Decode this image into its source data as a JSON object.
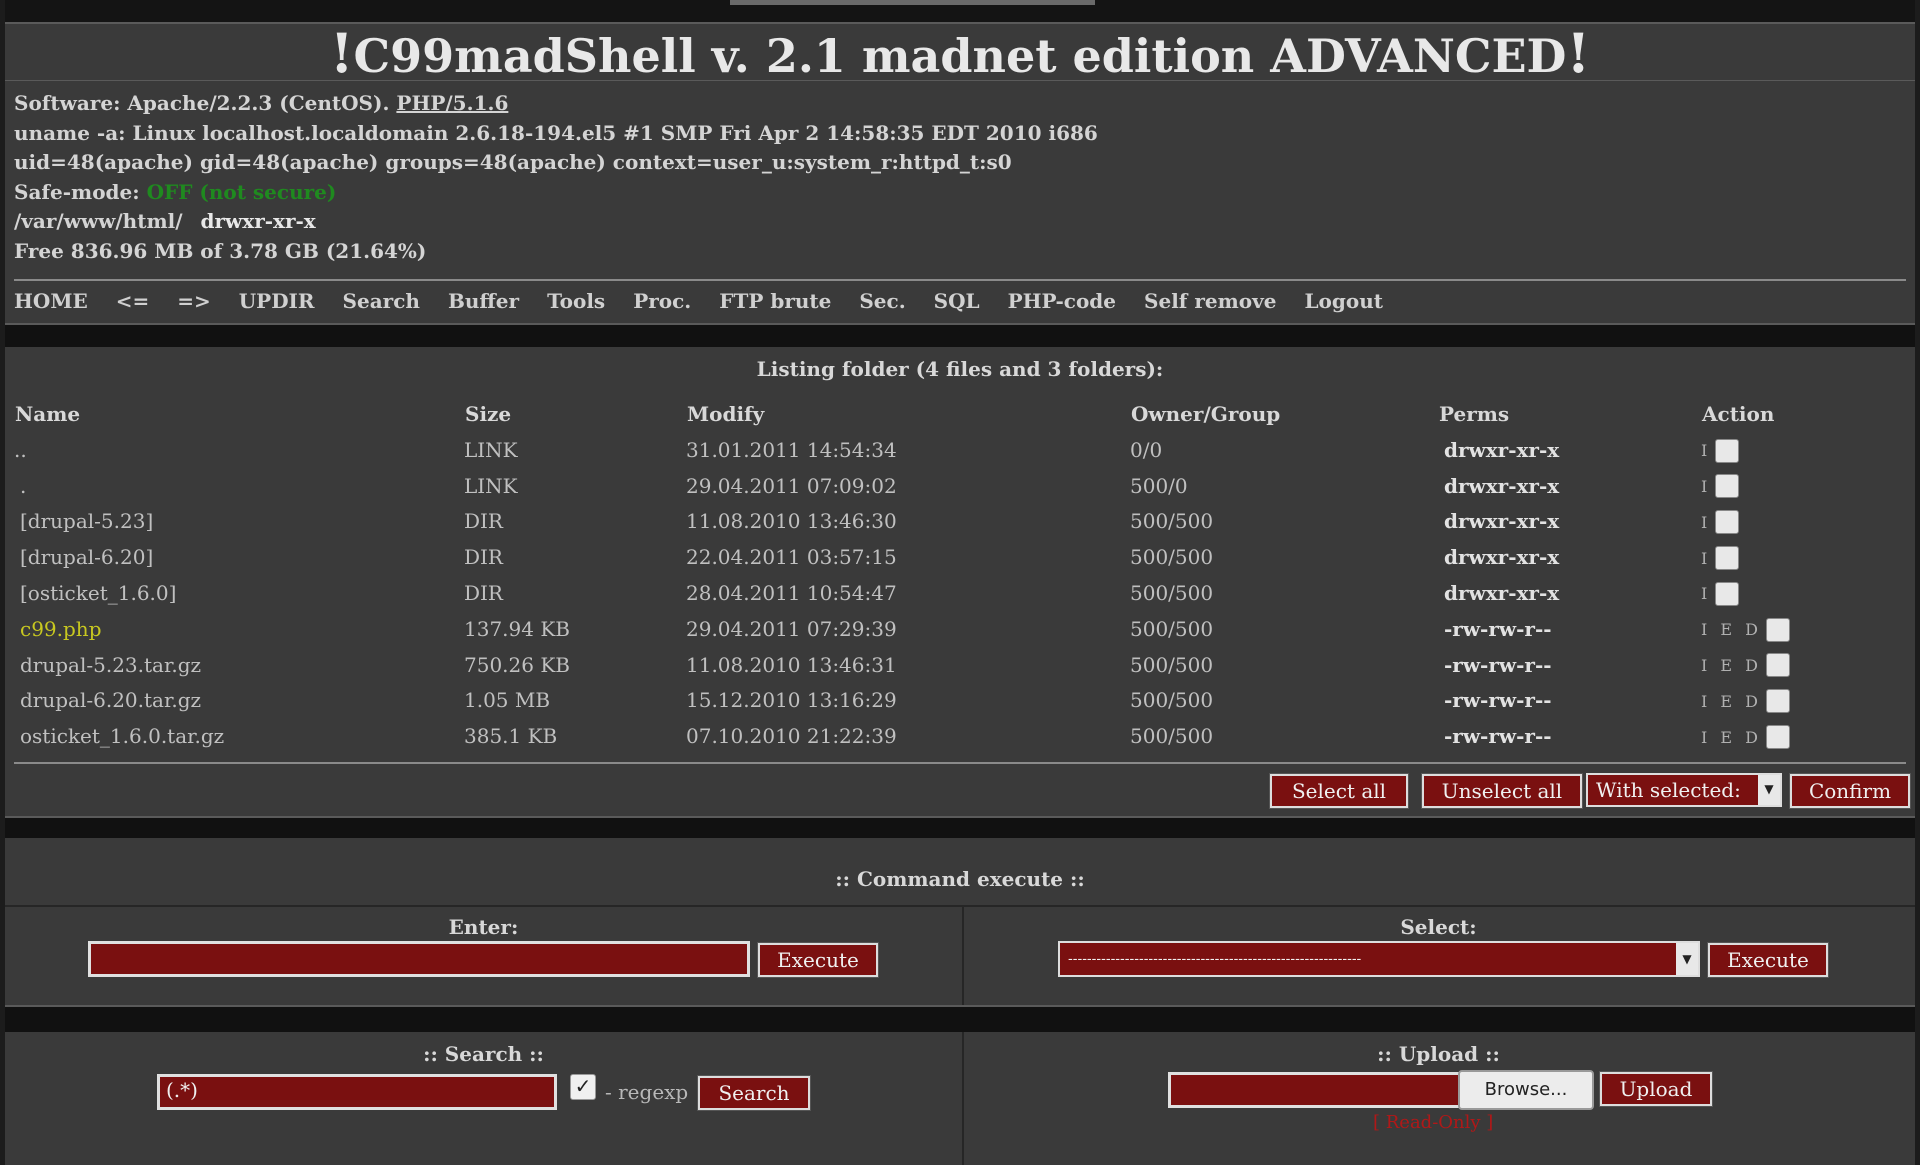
{
  "title": {
    "prefix": "!",
    "text": "C99madShell v. 2.1 madnet edition ADVANCED",
    "suffix": "!"
  },
  "info": {
    "software_label": "Software: Apache/2.2.3 (CentOS).",
    "software_php": "PHP/5.1.6",
    "uname": "uname -a: Linux localhost.localdomain 2.6.18-194.el5 #1 SMP Fri Apr 2 14:58:35 EDT 2010 i686",
    "uid": "uid=48(apache) gid=48(apache) groups=48(apache) context=user_u:system_r:httpd_t:s0",
    "safe_label": "Safe-mode:",
    "safe_value": "OFF (not secure)",
    "path": "/var/www/html/",
    "path_perms": "drwxr-xr-x",
    "free": "Free 836.96 MB of 3.78 GB (21.64%)"
  },
  "nav": [
    "HOME",
    "<=",
    "=>",
    "UPDIR",
    "Search",
    "Buffer",
    "Tools",
    "Proc.",
    "FTP brute",
    "Sec.",
    "SQL",
    "PHP-code",
    "Self remove",
    "Logout"
  ],
  "listing": {
    "heading": "Listing folder (4 files and 3 folders):",
    "columns": [
      "Name",
      "Size",
      "Modify",
      "Owner/Group",
      "Perms",
      "Action"
    ],
    "rows": [
      {
        "name": "..",
        "size": "LINK",
        "modify": "31.01.2011 14:54:34",
        "owner": "0/0",
        "perms": "drwxr-xr-x",
        "action": "I"
      },
      {
        "name": ".",
        "size": "LINK",
        "modify": "29.04.2011 07:09:02",
        "owner": "500/0",
        "perms": "drwxr-xr-x",
        "action": "I"
      },
      {
        "name": "[drupal-5.23]",
        "size": "DIR",
        "modify": "11.08.2010 13:46:30",
        "owner": "500/500",
        "perms": "drwxr-xr-x",
        "action": "I"
      },
      {
        "name": "[drupal-6.20]",
        "size": "DIR",
        "modify": "22.04.2011 03:57:15",
        "owner": "500/500",
        "perms": "drwxr-xr-x",
        "action": "I"
      },
      {
        "name": "[osticket_1.6.0]",
        "size": "DIR",
        "modify": "28.04.2011 10:54:47",
        "owner": "500/500",
        "perms": "drwxr-xr-x",
        "action": "I"
      },
      {
        "name": "c99.php",
        "size": "137.94 KB",
        "modify": "29.04.2011 07:29:39",
        "owner": "500/500",
        "perms": "-rw-rw-r--",
        "action": "I E D"
      },
      {
        "name": "drupal-5.23.tar.gz",
        "size": "750.26 KB",
        "modify": "11.08.2010 13:46:31",
        "owner": "500/500",
        "perms": "-rw-rw-r--",
        "action": "I E D"
      },
      {
        "name": "drupal-6.20.tar.gz",
        "size": "1.05 MB",
        "modify": "15.12.2010 13:16:29",
        "owner": "500/500",
        "perms": "-rw-rw-r--",
        "action": "I E D"
      },
      {
        "name": "osticket_1.6.0.tar.gz",
        "size": "385.1 KB",
        "modify": "07.10.2010 21:22:39",
        "owner": "500/500",
        "perms": "-rw-rw-r--",
        "action": "I E D"
      }
    ],
    "select_all": "Select all",
    "unselect_all": "Unselect all",
    "with_selected": "With selected:",
    "confirm": "Confirm"
  },
  "command": {
    "heading": ":: Command execute ::",
    "enter_label": "Enter:",
    "enter_value": "",
    "execute": "Execute",
    "select_label": "Select:",
    "select_value": "--------------------------------------------------------------",
    "execute2": "Execute"
  },
  "search": {
    "heading": ":: Search ::",
    "value": "(.*)",
    "regexp_label": "- regexp",
    "button": "Search"
  },
  "upload": {
    "heading": ":: Upload ::",
    "browse": "Browse...",
    "button": "Upload",
    "readonly": "[ Read-Only ]"
  },
  "colors": {
    "accent": "#7a1010",
    "safe": "#1f8a1f",
    "highlight": "#c8c820",
    "readonly": "#b01818"
  }
}
